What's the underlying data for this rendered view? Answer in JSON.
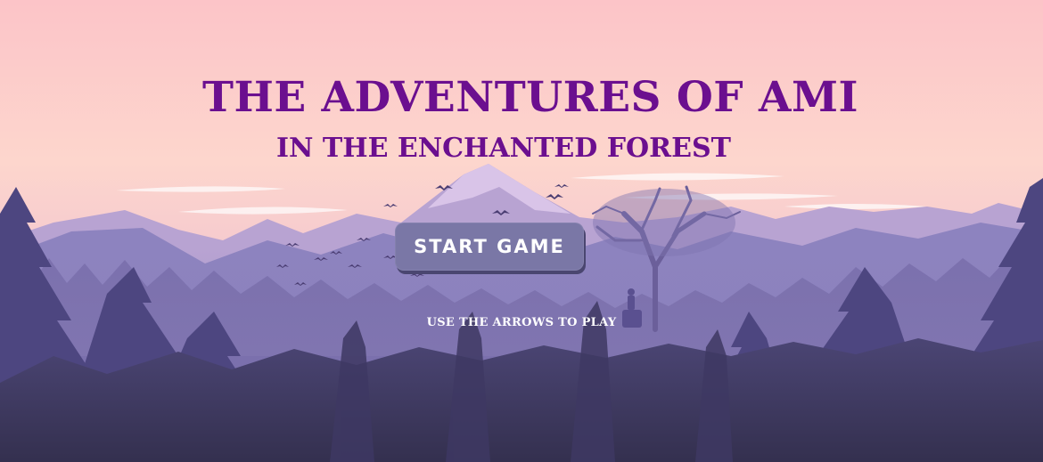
{
  "game": {
    "title": "The Adventures of Ami",
    "subtitle": "In the Enchanted Forest",
    "start_button_label": "Start Game",
    "instructions": "Use the arrows to play"
  },
  "colors": {
    "title": "#6b0f8f",
    "button_bg": "#7a77a6",
    "button_shadow": "#4a4670",
    "sky_top": "#fcc4c8",
    "forest_dark": "#2f2a4a"
  },
  "background": {
    "icons": [
      "mountain-range",
      "pine-forest",
      "bare-tree",
      "bird-flock",
      "hiker-silhouette"
    ]
  }
}
